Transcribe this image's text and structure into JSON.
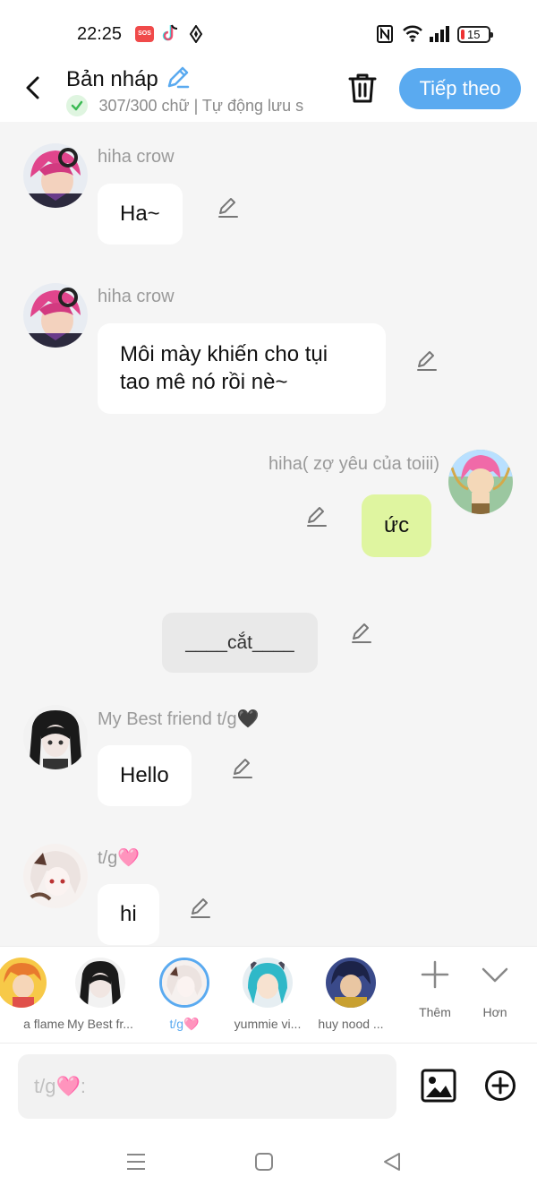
{
  "status": {
    "time": "22:25",
    "sos": "SOS",
    "battery": "15"
  },
  "header": {
    "title": "Bản nháp",
    "subtitle": "307/300 chữ | Tự động lưu s",
    "next_label": "Tiếp theo"
  },
  "messages": [
    {
      "sender": "hiha crow",
      "text": "Ha~"
    },
    {
      "sender": "hiha crow",
      "text": "Môi mày khiến cho tụi tao mê nó rồi nè~"
    },
    {
      "sender": "hiha( zợ yêu của toiii)",
      "text": "ức"
    },
    {
      "text": "____cắt____"
    },
    {
      "sender": "My Best friend t/g🖤",
      "text": "Hello"
    },
    {
      "sender": "t/g🩷",
      "text": "hi"
    }
  ],
  "characters": [
    {
      "name": "a flame"
    },
    {
      "name": "My Best fr..."
    },
    {
      "name": "t/g🩷"
    },
    {
      "name": "yummie vi..."
    },
    {
      "name": "huy nood ..."
    }
  ],
  "actions": {
    "add_label": "Thêm",
    "more_label": "Hơn"
  },
  "input": {
    "placeholder": "t/g🩷:"
  },
  "colors": {
    "accent": "#5aaaf0",
    "bubble_self": "#dff5a0",
    "background": "#f5f5f5"
  }
}
